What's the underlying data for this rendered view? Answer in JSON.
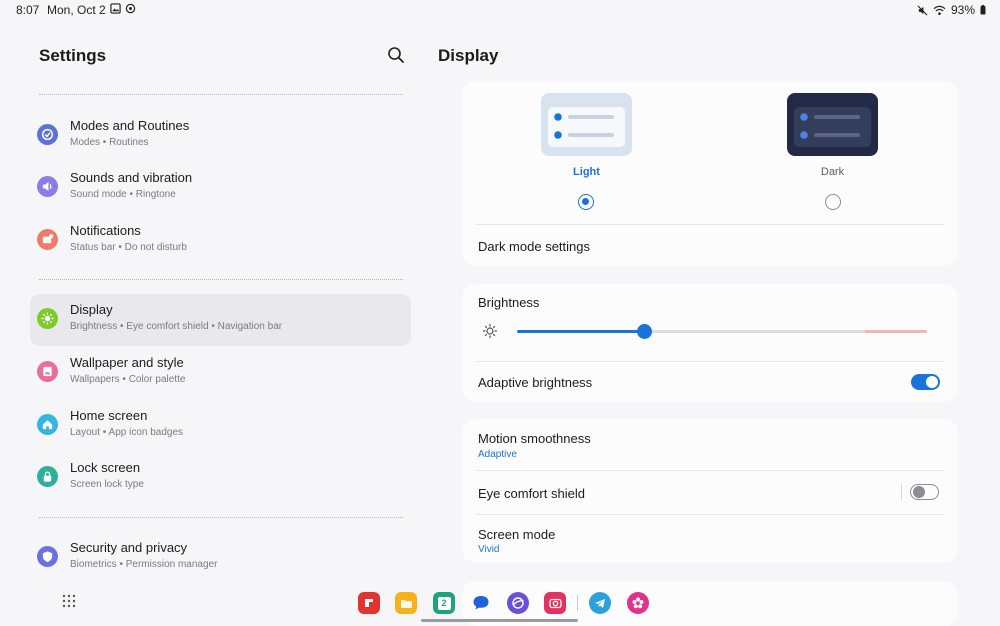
{
  "status_bar": {
    "time": "8:07",
    "date": "Mon, Oct 2",
    "battery": "93%"
  },
  "left_pane": {
    "title": "Settings",
    "items": [
      {
        "title": "Modes and Routines",
        "subtitle": "Modes • Routines",
        "icon": "check-circle-icon",
        "color": "#5b72d6"
      },
      {
        "title": "Sounds and vibration",
        "subtitle": "Sound mode • Ringtone",
        "icon": "speaker-icon",
        "color": "#8c7ce8"
      },
      {
        "title": "Notifications",
        "subtitle": "Status bar • Do not disturb",
        "icon": "notification-icon",
        "color": "#ef7b6b"
      },
      {
        "title": "Display",
        "subtitle": "Brightness • Eye comfort shield • Navigation bar",
        "icon": "sun-icon",
        "color": "#7ecb2d"
      },
      {
        "title": "Wallpaper and style",
        "subtitle": "Wallpapers • Color palette",
        "icon": "image-icon",
        "color": "#ea6e9a"
      },
      {
        "title": "Home screen",
        "subtitle": "Layout • App icon badges",
        "icon": "home-icon",
        "color": "#35b6e0"
      },
      {
        "title": "Lock screen",
        "subtitle": "Screen lock type",
        "icon": "lock-icon",
        "color": "#2fb09b"
      },
      {
        "title": "Security and privacy",
        "subtitle": "Biometrics • Permission manager",
        "icon": "shield-icon",
        "color": "#6a72e0"
      }
    ]
  },
  "right_pane": {
    "title": "Display",
    "theme": {
      "light_label": "Light",
      "dark_label": "Dark",
      "selected": "Light",
      "dark_mode_settings": "Dark mode settings"
    },
    "brightness": {
      "label": "Brightness",
      "level": 0.31,
      "adaptive_label": "Adaptive brightness",
      "adaptive_on": true
    },
    "motion": {
      "label": "Motion smoothness",
      "value": "Adaptive"
    },
    "eye_comfort": {
      "label": "Eye comfort shield",
      "on": false
    },
    "screen_mode": {
      "label": "Screen mode",
      "value": "Vivid"
    }
  },
  "colors": {
    "accent": "#1a73d9",
    "background": "#f6f6f8",
    "card": "#fcfcfd",
    "active_item": "#e9e9ec"
  },
  "dock": {
    "apps": [
      {
        "name": "flipboard-icon",
        "color": "#e2342f"
      },
      {
        "name": "folder-icon",
        "color": "#f6b21b"
      },
      {
        "name": "calendar-icon",
        "color": "#1fa37e",
        "text": "2"
      },
      {
        "name": "messages-icon",
        "color": "#1e64d6"
      },
      {
        "name": "internet-icon",
        "color": "#6b4fd8"
      },
      {
        "name": "camera-icon",
        "color": "#e3325f"
      },
      {
        "name": "telegram-icon",
        "color": "#2aa2dc"
      },
      {
        "name": "blossom-icon",
        "color": "#e0328c"
      }
    ]
  }
}
